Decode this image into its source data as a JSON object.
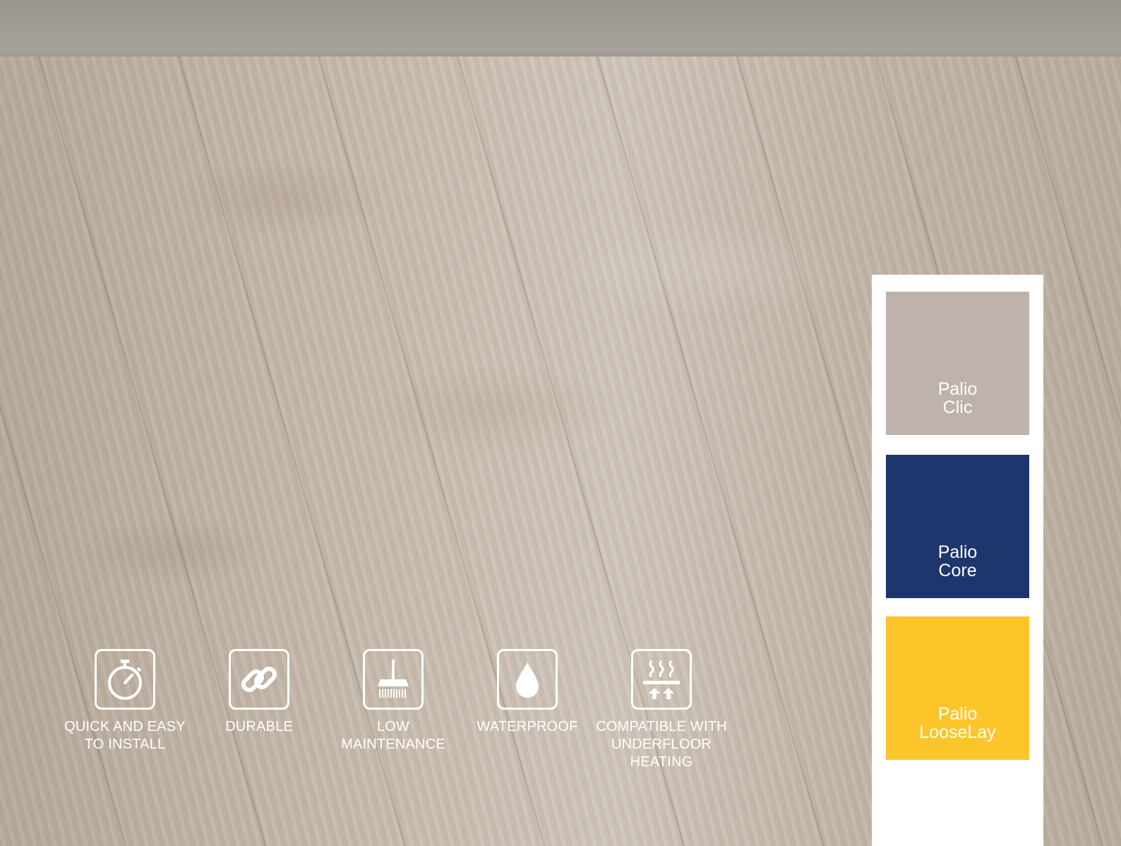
{
  "features": [
    {
      "icon": "stopwatch-icon",
      "label": "QUICK AND EASY\nTO INSTALL"
    },
    {
      "icon": "chain-link-icon",
      "label": "DURABLE"
    },
    {
      "icon": "broom-icon",
      "label": "LOW\nMAINTENANCE"
    },
    {
      "icon": "water-drop-icon",
      "label": "WATERPROOF"
    },
    {
      "icon": "underfloor-heating-icon",
      "label": "COMPATIBLE WITH\nUNDERFLOOR\nHEATING"
    }
  ],
  "products": [
    {
      "label": "Palio\nClic",
      "color": "#bdb3ac"
    },
    {
      "label": "Palio\nCore",
      "color": "#1e356e"
    },
    {
      "label": "Palio\nLooseLay",
      "color": "#fcc62a"
    }
  ]
}
